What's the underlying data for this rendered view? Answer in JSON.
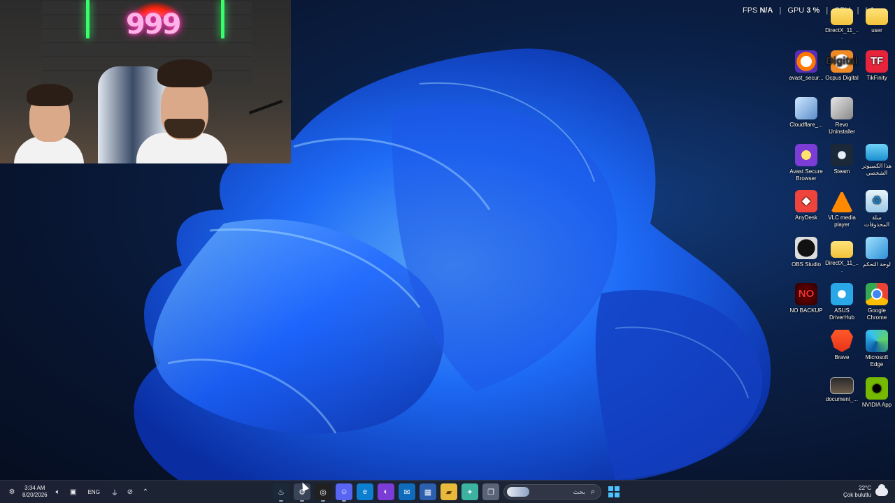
{
  "hud": {
    "fps_label": "FPS",
    "fps_value": "N/A",
    "gpu_label": "GPU",
    "gpu_value": "3 %",
    "cpu_label": "CPU",
    "lan_label": "LA"
  },
  "webcam": {
    "neon_text": "999"
  },
  "desktop_icons": [
    {
      "label": "DirectX_11_...",
      "icon": "folder-icon"
    },
    {
      "label": "user",
      "icon": "folder-icon"
    },
    {
      "label": "avast_secur...",
      "icon": "avast-icon"
    },
    {
      "label": "Ocpus Digital",
      "icon": "ocpus-icon",
      "glyph": "Digital"
    },
    {
      "label": "TikFinity",
      "icon": "tikfinity-icon",
      "glyph": "TF"
    },
    {
      "label": "Cloudflare_...",
      "icon": "cloudflare-installer-icon"
    },
    {
      "label": "Revo Uninstaller",
      "icon": "revo-uninstaller-icon"
    },
    {
      "label": "Avast Secure Browser",
      "icon": "avast-browser-icon"
    },
    {
      "label": "Steam",
      "icon": "steam-icon"
    },
    {
      "label": "هذا الكمبيوتر الشخصي",
      "icon": "this-pc-icon"
    },
    {
      "label": "AnyDesk",
      "icon": "anydesk-icon",
      "glyph": "◆"
    },
    {
      "label": "VLC media player",
      "icon": "vlc-icon"
    },
    {
      "label": "سلة المحذوفات",
      "icon": "recycle-bin-icon",
      "glyph": "♻"
    },
    {
      "label": "OBS Studio",
      "icon": "obs-icon"
    },
    {
      "label": "DirectX_11_...",
      "icon": "folder-icon"
    },
    {
      "label": "لوحة التحكم",
      "icon": "control-panel-icon"
    },
    {
      "label": "NO BACKUP",
      "icon": "no-backup-icon",
      "glyph": "NO"
    },
    {
      "label": "ASUS DriverHub",
      "icon": "asus-driverhub-icon"
    },
    {
      "label": "Google Chrome",
      "icon": "chrome-icon"
    },
    {
      "label": "Brave",
      "icon": "brave-icon"
    },
    {
      "label": "Microsoft Edge",
      "icon": "edge-icon"
    },
    {
      "label": "document_...",
      "icon": "document-icon"
    },
    {
      "label": "NVIDIA App",
      "icon": "nvidia-icon",
      "glyph": "◉"
    }
  ],
  "taskbar": {
    "time": "3:34 AM",
    "date": "8/20/2026",
    "language": "ENG",
    "search_placeholder": "بحث",
    "weather_temp": "22°C",
    "weather_desc": "Çok bulutlu",
    "pinned": [
      {
        "icon": "steam-icon",
        "glyph": "♨",
        "color": "#1b2838"
      },
      {
        "icon": "settings-icon",
        "glyph": "⚙",
        "color": "#3a4458"
      },
      {
        "icon": "obs-icon",
        "glyph": "◎",
        "color": "#202020"
      },
      {
        "icon": "discord-icon",
        "glyph": "☺",
        "color": "#5865f2"
      },
      {
        "icon": "edge-icon",
        "glyph": "e",
        "color": "#0c7fd0"
      },
      {
        "icon": "avast-browser-icon",
        "glyph": "◐",
        "color": "#7c3cd6"
      },
      {
        "icon": "mail-icon",
        "glyph": "✉",
        "color": "#0f6cbd"
      },
      {
        "icon": "store-icon",
        "glyph": "▦",
        "color": "#2c5fb0"
      },
      {
        "icon": "file-explorer-icon",
        "glyph": "▰",
        "color": "#e8b93a"
      },
      {
        "icon": "copilot-icon",
        "glyph": "✦",
        "color": "#3bb3a0"
      },
      {
        "icon": "task-view-icon",
        "glyph": "❐",
        "color": "#5a6478"
      }
    ]
  },
  "colors": {
    "accent": "#4cc2ff",
    "neon_green": "#37ff6a",
    "neon_pink": "#ff40c8"
  }
}
